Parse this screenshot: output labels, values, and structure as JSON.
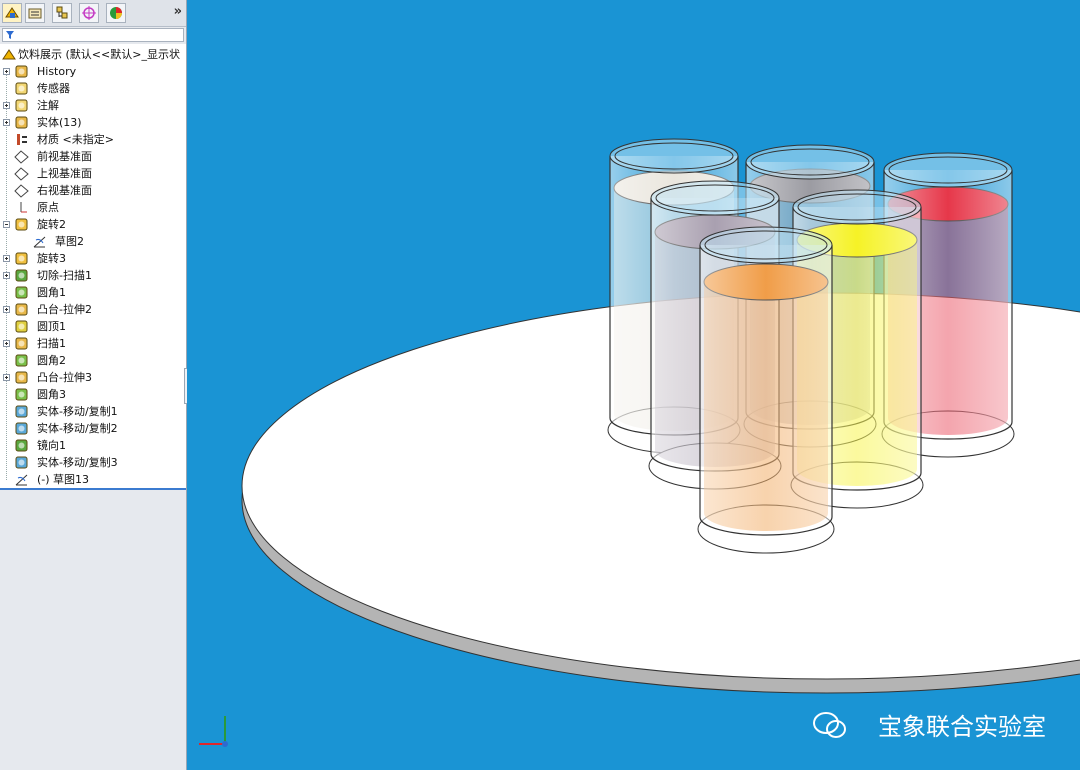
{
  "panel": {
    "tabs": [
      "feature-manager-tab",
      "property-manager-tab",
      "configuration-manager-tab",
      "dimxpert-tab",
      "display-manager-tab"
    ],
    "more": "»"
  },
  "tree": {
    "root": "饮料展示  (默认<<默认>_显示状",
    "items": [
      {
        "label": "History",
        "icon": "history-icon",
        "exp": "plus"
      },
      {
        "label": "传感器",
        "icon": "sensor-icon",
        "exp": ""
      },
      {
        "label": "注解",
        "icon": "annotation-icon",
        "exp": "plus"
      },
      {
        "label": "实体(13)",
        "icon": "solid-bodies-icon",
        "exp": "plus"
      },
      {
        "label": "材质 <未指定>",
        "icon": "material-icon",
        "exp": ""
      },
      {
        "label": "前视基准面",
        "icon": "plane-icon",
        "exp": ""
      },
      {
        "label": "上视基准面",
        "icon": "plane-icon",
        "exp": ""
      },
      {
        "label": "右视基准面",
        "icon": "plane-icon",
        "exp": ""
      },
      {
        "label": "原点",
        "icon": "origin-icon",
        "exp": ""
      },
      {
        "label": "旋转2",
        "icon": "revolve-icon",
        "exp": "minus"
      },
      {
        "label": "草图2",
        "icon": "sketch-icon",
        "exp": "",
        "child": true
      },
      {
        "label": "旋转3",
        "icon": "revolve-icon",
        "exp": "plus"
      },
      {
        "label": "切除-扫描1",
        "icon": "cut-sweep-icon",
        "exp": "plus"
      },
      {
        "label": "圆角1",
        "icon": "fillet-icon",
        "exp": ""
      },
      {
        "label": "凸台-拉伸2",
        "icon": "boss-extrude-icon",
        "exp": "plus"
      },
      {
        "label": "圆顶1",
        "icon": "dome-icon",
        "exp": ""
      },
      {
        "label": "扫描1",
        "icon": "sweep-icon",
        "exp": "plus"
      },
      {
        "label": "圆角2",
        "icon": "fillet-icon",
        "exp": ""
      },
      {
        "label": "凸台-拉伸3",
        "icon": "boss-extrude-icon",
        "exp": "plus"
      },
      {
        "label": "圆角3",
        "icon": "fillet-icon",
        "exp": ""
      },
      {
        "label": "实体-移动/复制1",
        "icon": "move-copy-icon",
        "exp": ""
      },
      {
        "label": "实体-移动/复制2",
        "icon": "move-copy-icon",
        "exp": ""
      },
      {
        "label": "镜向1",
        "icon": "mirror-icon",
        "exp": ""
      },
      {
        "label": "实体-移动/复制3",
        "icon": "move-copy-icon",
        "exp": ""
      },
      {
        "label": "(-) 草图13",
        "icon": "sketch-icon",
        "exp": ""
      }
    ]
  },
  "viewport": {
    "background": "#1a94d4",
    "glasses": [
      {
        "name": "glass-white-milk",
        "liquid": "#e6e2d8"
      },
      {
        "name": "glass-gray",
        "liquid": "#8a8a92"
      },
      {
        "name": "glass-red",
        "liquid": "#e2142a"
      },
      {
        "name": "glass-lavender",
        "liquid": "#9a8fa2"
      },
      {
        "name": "glass-yellow",
        "liquid": "#f4f000"
      },
      {
        "name": "glass-orange",
        "liquid": "#ee8c28"
      }
    ]
  },
  "watermark": "宝象联合实验室"
}
